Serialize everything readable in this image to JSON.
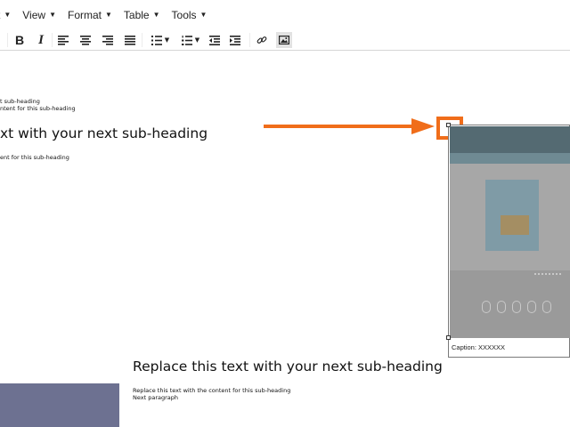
{
  "menubar": {
    "items": [
      {
        "label": "t",
        "caret": "▼"
      },
      {
        "label": "View",
        "caret": "▼"
      },
      {
        "label": "Format",
        "caret": "▼"
      },
      {
        "label": "Table",
        "caret": "▼"
      },
      {
        "label": "Tools",
        "caret": "▼"
      }
    ]
  },
  "toolbar": {
    "bold": "B",
    "italic": "I",
    "dropdown_caret": "▼",
    "icons": [
      "bold-icon",
      "italic-icon",
      "align-left-icon",
      "align-center-icon",
      "align-right-icon",
      "align-justify-icon",
      "bullet-list-icon",
      "numbered-list-icon",
      "outdent-icon",
      "indent-icon",
      "link-icon",
      "image-icon"
    ],
    "active_button": "image-icon"
  },
  "document": {
    "line1": "t sub-heading",
    "line2": "ntent for this sub-heading",
    "heading1": "xt with your next sub-heading",
    "line3": "ent for this sub-heading",
    "image_caption": "Caption: XXXXXX",
    "heading2": "Replace this text with your next sub-heading",
    "para1": "Replace this text with the content for this sub-heading",
    "para2": "Next paragraph"
  },
  "colors": {
    "arrow": "#f06d1a",
    "highlight": "#f06d1a",
    "block_image": "#6d7191",
    "active_toolbar_button": "#e2e2e2"
  }
}
